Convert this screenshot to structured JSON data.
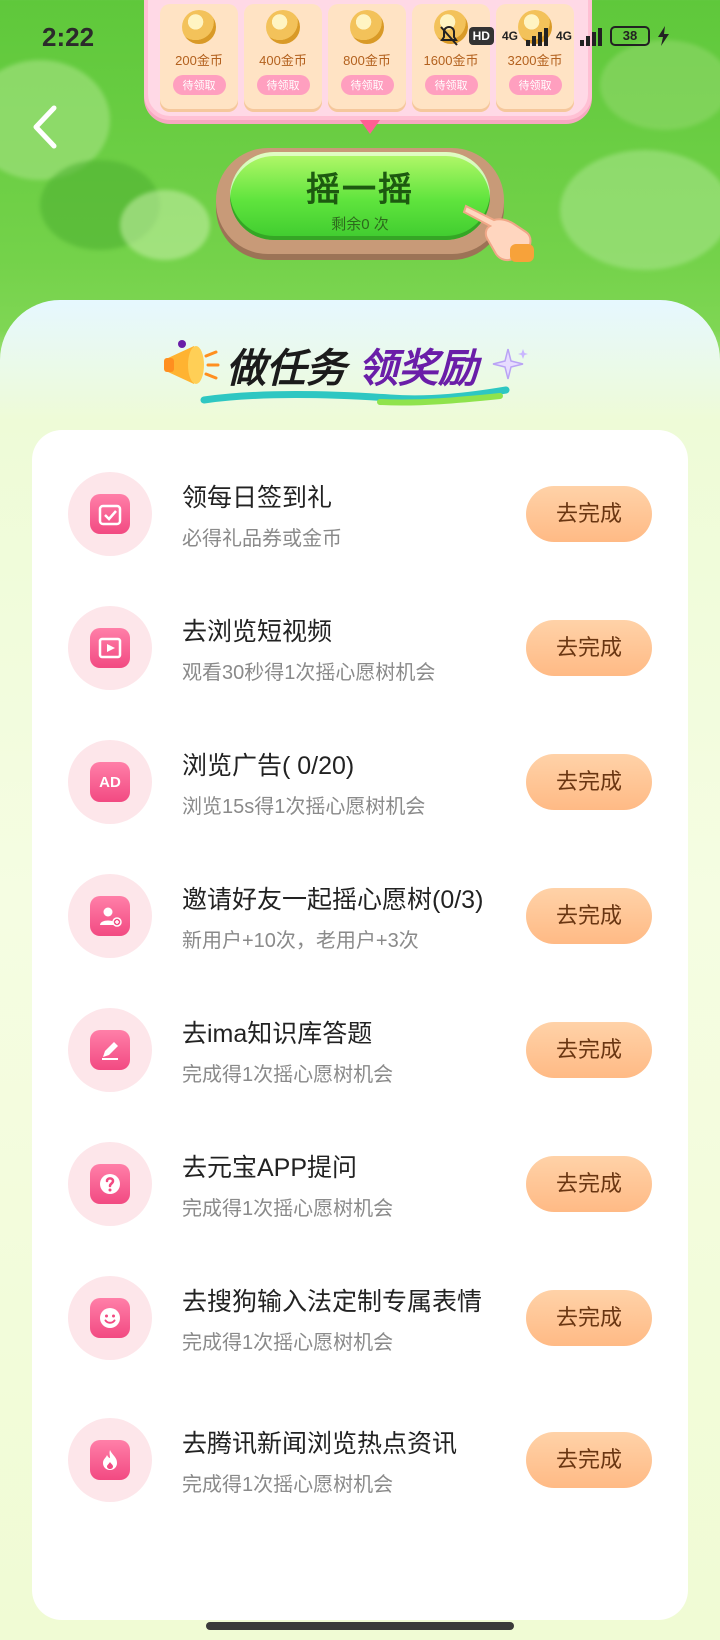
{
  "status_bar": {
    "time": "2:22",
    "hd_badge": "HD",
    "network_1": "4G",
    "network_2": "4G",
    "battery": "38"
  },
  "rewards": [
    {
      "amount": "200金币",
      "status": "待领取"
    },
    {
      "amount": "400金币",
      "status": "待领取"
    },
    {
      "amount": "800金币",
      "status": "待领取"
    },
    {
      "amount": "1600金币",
      "status": "待领取"
    },
    {
      "amount": "3200金币",
      "status": "待领取"
    }
  ],
  "shake": {
    "label": "摇一摇",
    "remaining": "剩余0 次"
  },
  "section": {
    "title_part1": "做任务",
    "title_part2": "领奖励"
  },
  "tasks": [
    {
      "title": "领每日签到礼",
      "subtitle": "必得礼品券或金币",
      "button": "去完成",
      "icon": "calendar-check-icon"
    },
    {
      "title": "去浏览短视频",
      "subtitle": "观看30秒得1次摇心愿树机会",
      "button": "去完成",
      "icon": "video-play-icon"
    },
    {
      "title": "浏览广告( 0/20)",
      "subtitle": "浏览15s得1次摇心愿树机会",
      "button": "去完成",
      "icon": "ad-icon"
    },
    {
      "title": "邀请好友一起摇心愿树(0/3)",
      "subtitle": "新用户+10次，老用户+3次",
      "button": "去完成",
      "icon": "add-user-icon"
    },
    {
      "title": "去ima知识库答题",
      "subtitle": "完成得1次摇心愿树机会",
      "button": "去完成",
      "icon": "pencil-icon"
    },
    {
      "title": "去元宝APP提问",
      "subtitle": "完成得1次摇心愿树机会",
      "button": "去完成",
      "icon": "question-icon"
    },
    {
      "title": "去搜狗输入法定制专属表情",
      "subtitle": "完成得1次摇心愿树机会",
      "button": "去完成",
      "icon": "smile-icon"
    },
    {
      "title": "去腾讯新闻浏览热点资讯",
      "subtitle": "完成得1次摇心愿树机会",
      "button": "去完成",
      "icon": "fire-icon"
    }
  ],
  "colors": {
    "accent_pink": "#f24a82",
    "button_orange": "#ffba85",
    "title_purple": "#6a1ea8",
    "shake_green": "#5fe43d"
  }
}
